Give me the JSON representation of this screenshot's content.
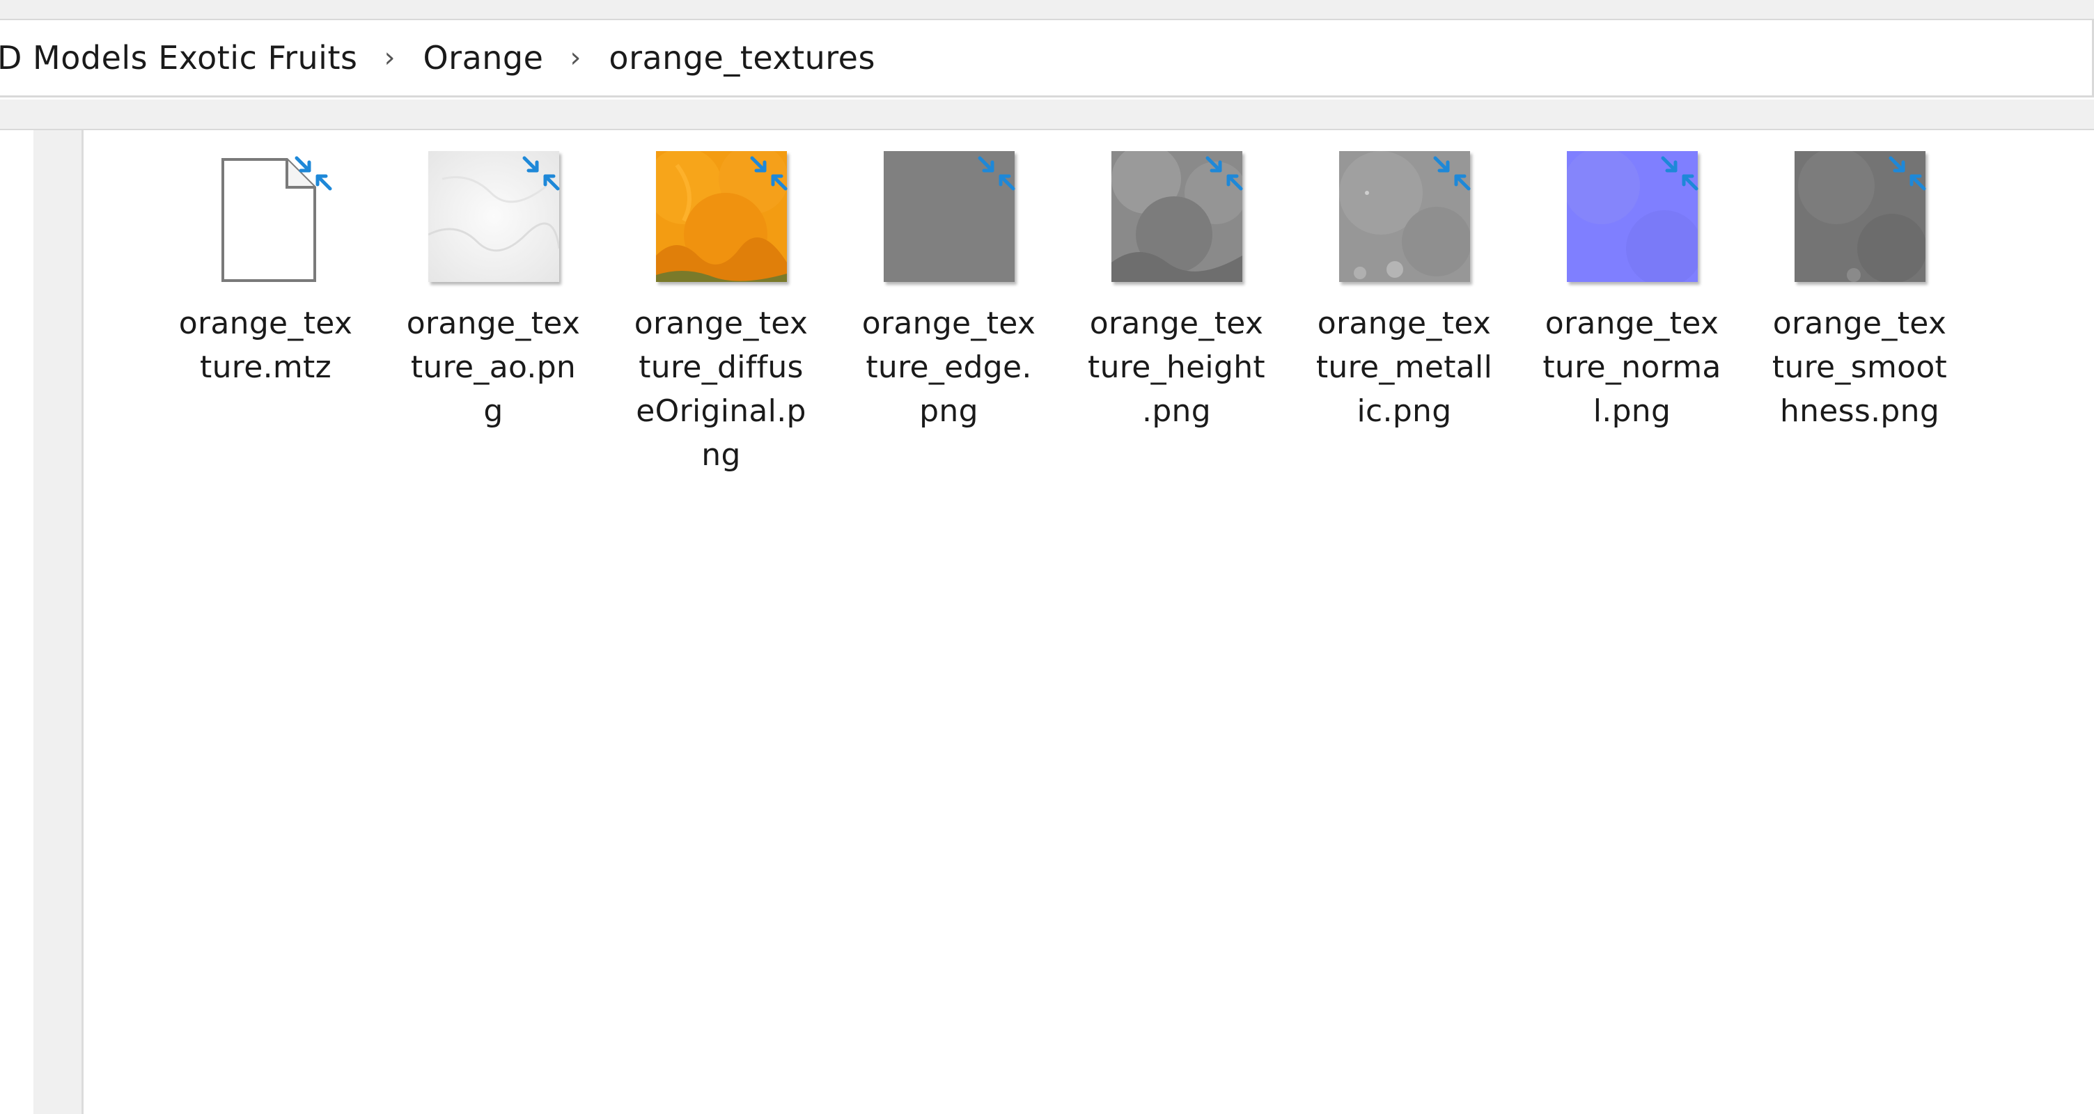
{
  "breadcrumb": {
    "items": [
      "D Models Exotic Fruits",
      "Orange",
      "orange_textures"
    ],
    "separator": "›"
  },
  "files": [
    {
      "name": "orange_texture.mtz",
      "label_lines": "orange_tex\nture.mtz",
      "thumbnail": "document-icon",
      "compressed": true
    },
    {
      "name": "orange_texture_ao.png",
      "label_lines": "orange_tex\nture_ao.pn\ng",
      "thumbnail": "ao-map",
      "compressed": true
    },
    {
      "name": "orange_texture_diffuseOriginal.png",
      "label_lines": "orange_tex\nture_diffus\neOriginal.p\nng",
      "thumbnail": "orange-diffuse",
      "compressed": true
    },
    {
      "name": "orange_texture_edge.png",
      "label_lines": "orange_tex\nture_edge.\npng",
      "thumbnail": "gray-flat",
      "compressed": true
    },
    {
      "name": "orange_texture_height.png",
      "label_lines": "orange_tex\nture_height\n.png",
      "thumbnail": "gray-height",
      "compressed": true
    },
    {
      "name": "orange_texture_metallic.png",
      "label_lines": "orange_tex\nture_metall\nic.png",
      "thumbnail": "gray-metallic",
      "compressed": true
    },
    {
      "name": "orange_texture_normal.png",
      "label_lines": "orange_tex\nture_norma\nl.png",
      "thumbnail": "normal-map",
      "compressed": true
    },
    {
      "name": "orange_texture_smoothness.png",
      "label_lines": "orange_tex\nture_smoot\nhness.png",
      "thumbnail": "gray-smooth",
      "compressed": true
    }
  ],
  "colors": {
    "compress_arrow": "#1e88d8",
    "orange": "#f39c12",
    "normal": "#7f7fff",
    "edge_gray": "#808080"
  }
}
